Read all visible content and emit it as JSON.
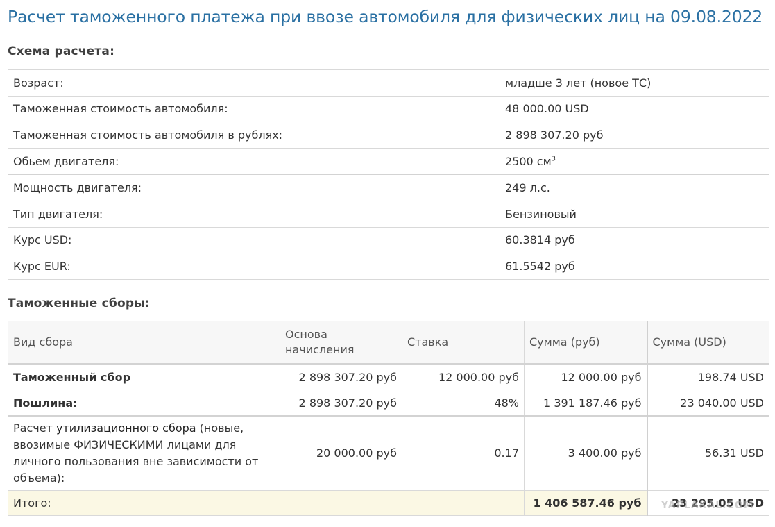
{
  "title": "Расчет таможенного платежа при ввозе автомобиля для физических лиц на 09.08.2022",
  "scheme": {
    "heading": "Схема расчета:",
    "rows": [
      {
        "label": "Возраст:",
        "value": "младше 3 лет (новое ТС)"
      },
      {
        "label": "Таможенная стоимость автомобиля:",
        "value": "48 000.00 USD"
      },
      {
        "label": "Таможенная стоимость автомобиля в рублях:",
        "value": "2 898 307.20 руб"
      },
      {
        "label": "Обьем двигателя:",
        "value": "2500 см",
        "sup": "3"
      },
      {
        "label": "Мощность двигателя:",
        "value": "249 л.с."
      },
      {
        "label": "Тип двигателя:",
        "value": "Бензиновый"
      },
      {
        "label": "Курс USD:",
        "value": "60.3814 руб"
      },
      {
        "label": "Курс EUR:",
        "value": "61.5542 руб"
      }
    ]
  },
  "fees": {
    "heading": "Таможенные сборы:",
    "headers": [
      "Вид сбора",
      "Основа начисления",
      "Ставка",
      "Сумма (руб)",
      "Сумма (USD)"
    ],
    "rows": [
      {
        "name": "Таможенный сбор",
        "base": "2 898 307.20 руб",
        "rate": "12 000.00 руб",
        "rub": "12 000.00 руб",
        "usd": "198.74 USD"
      },
      {
        "name": "Пошлина:",
        "base": "2 898 307.20 руб",
        "rate": "48%",
        "rub": "1 391 187.46 руб",
        "usd": "23 040.00 USD"
      },
      {
        "name_prefix": "Расчет ",
        "name_link": "утилизационного сбора",
        "name_suffix": " (новые, ввозимые ФИЗИЧЕСКИМИ лицами для личного пользования вне зависимости от объема):",
        "base": "20 000.00 руб",
        "rate": "0.17",
        "rub": "3 400.00 руб",
        "usd": "56.31 USD"
      }
    ],
    "total": {
      "label": "Итого:",
      "rub": "1 406 587.46 руб",
      "usd": "23 295.05 USD"
    }
  },
  "watermark": "YAPLAKAL.COM"
}
